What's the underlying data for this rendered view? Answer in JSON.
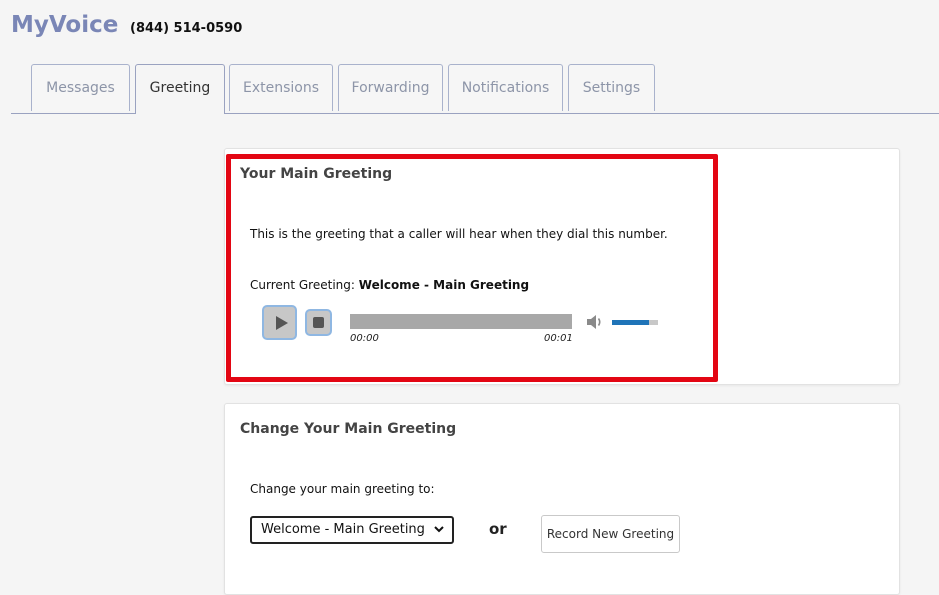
{
  "header": {
    "app_title": "MyVoice",
    "phone_number": "(844) 514-0590"
  },
  "tabs": [
    {
      "label": "Messages",
      "active": false
    },
    {
      "label": "Greeting",
      "active": true
    },
    {
      "label": "Extensions",
      "active": false
    },
    {
      "label": "Forwarding",
      "active": false
    },
    {
      "label": "Notifications",
      "active": false
    },
    {
      "label": "Settings",
      "active": false
    }
  ],
  "main_greeting": {
    "title": "Your Main Greeting",
    "description": "This is the greeting that a caller will hear when they dial this number.",
    "current_label": "Current Greeting:",
    "current_value": "Welcome - Main Greeting",
    "player": {
      "time_current": "00:00",
      "time_total": "00:01",
      "playback_progress": 0,
      "volume_level": 0.8
    }
  },
  "change_greeting": {
    "title": "Change Your Main Greeting",
    "label": "Change your main greeting to:",
    "selected_option": "Welcome - Main Greeting",
    "or_text": "or",
    "record_button_label": "Record New Greeting"
  },
  "colors": {
    "brand": "#7a86b6",
    "highlight_border": "#e30613",
    "volume_fill": "#1f74b8",
    "tab_border": "#a9b2cc"
  }
}
